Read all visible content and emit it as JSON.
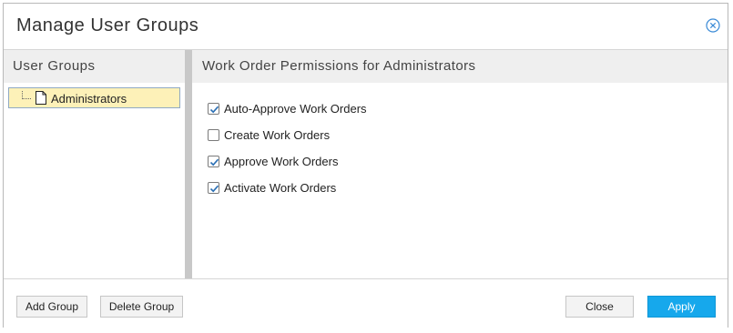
{
  "dialog": {
    "title": "Manage User Groups",
    "close_icon": "close-circle-icon"
  },
  "left_panel": {
    "header": "User Groups",
    "items": [
      {
        "label": "Administrators",
        "icon": "document-icon",
        "selected": true
      }
    ]
  },
  "right_panel": {
    "header": "Work Order Permissions for Administrators",
    "permissions": [
      {
        "label": "Auto-Approve Work Orders",
        "checked": true
      },
      {
        "label": "Create Work Orders",
        "checked": false
      },
      {
        "label": "Approve Work Orders",
        "checked": true
      },
      {
        "label": "Activate Work Orders",
        "checked": true
      }
    ]
  },
  "footer": {
    "add_group": "Add Group",
    "delete_group": "Delete Group",
    "close": "Close",
    "apply": "Apply"
  },
  "colors": {
    "selection_bg": "#fdf1b8",
    "apply_button": "#16a8ec",
    "checkmark": "#2a6fb4"
  }
}
